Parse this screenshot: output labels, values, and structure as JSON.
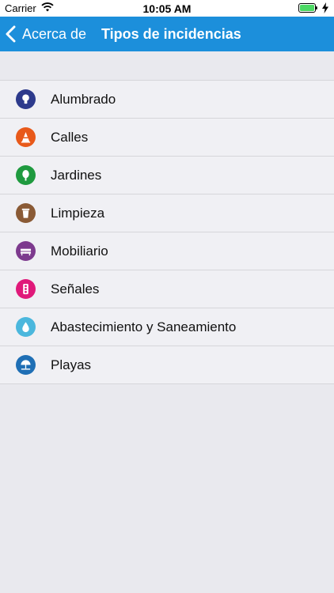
{
  "status_bar": {
    "carrier": "Carrier",
    "time": "10:05 AM"
  },
  "nav": {
    "back_label": "Acerca de",
    "title": "Tipos de incidencias",
    "color": "#1c8fdb"
  },
  "items": [
    {
      "label": "Alumbrado",
      "icon": "lightbulb-icon",
      "color": "#2d3a8c"
    },
    {
      "label": "Calles",
      "icon": "traffic-cone-icon",
      "color": "#e8591a"
    },
    {
      "label": "Jardines",
      "icon": "tree-icon",
      "color": "#1f9a3f"
    },
    {
      "label": "Limpieza",
      "icon": "trash-bin-icon",
      "color": "#8a5a35"
    },
    {
      "label": "Mobiliario",
      "icon": "bench-icon",
      "color": "#7d3a8e"
    },
    {
      "label": "Señales",
      "icon": "traffic-light-icon",
      "color": "#e0197a"
    },
    {
      "label": "Abastecimiento y Saneamiento",
      "icon": "water-drop-icon",
      "color": "#4bb7dd"
    },
    {
      "label": "Playas",
      "icon": "beach-umbrella-icon",
      "color": "#1f6fb5"
    }
  ]
}
